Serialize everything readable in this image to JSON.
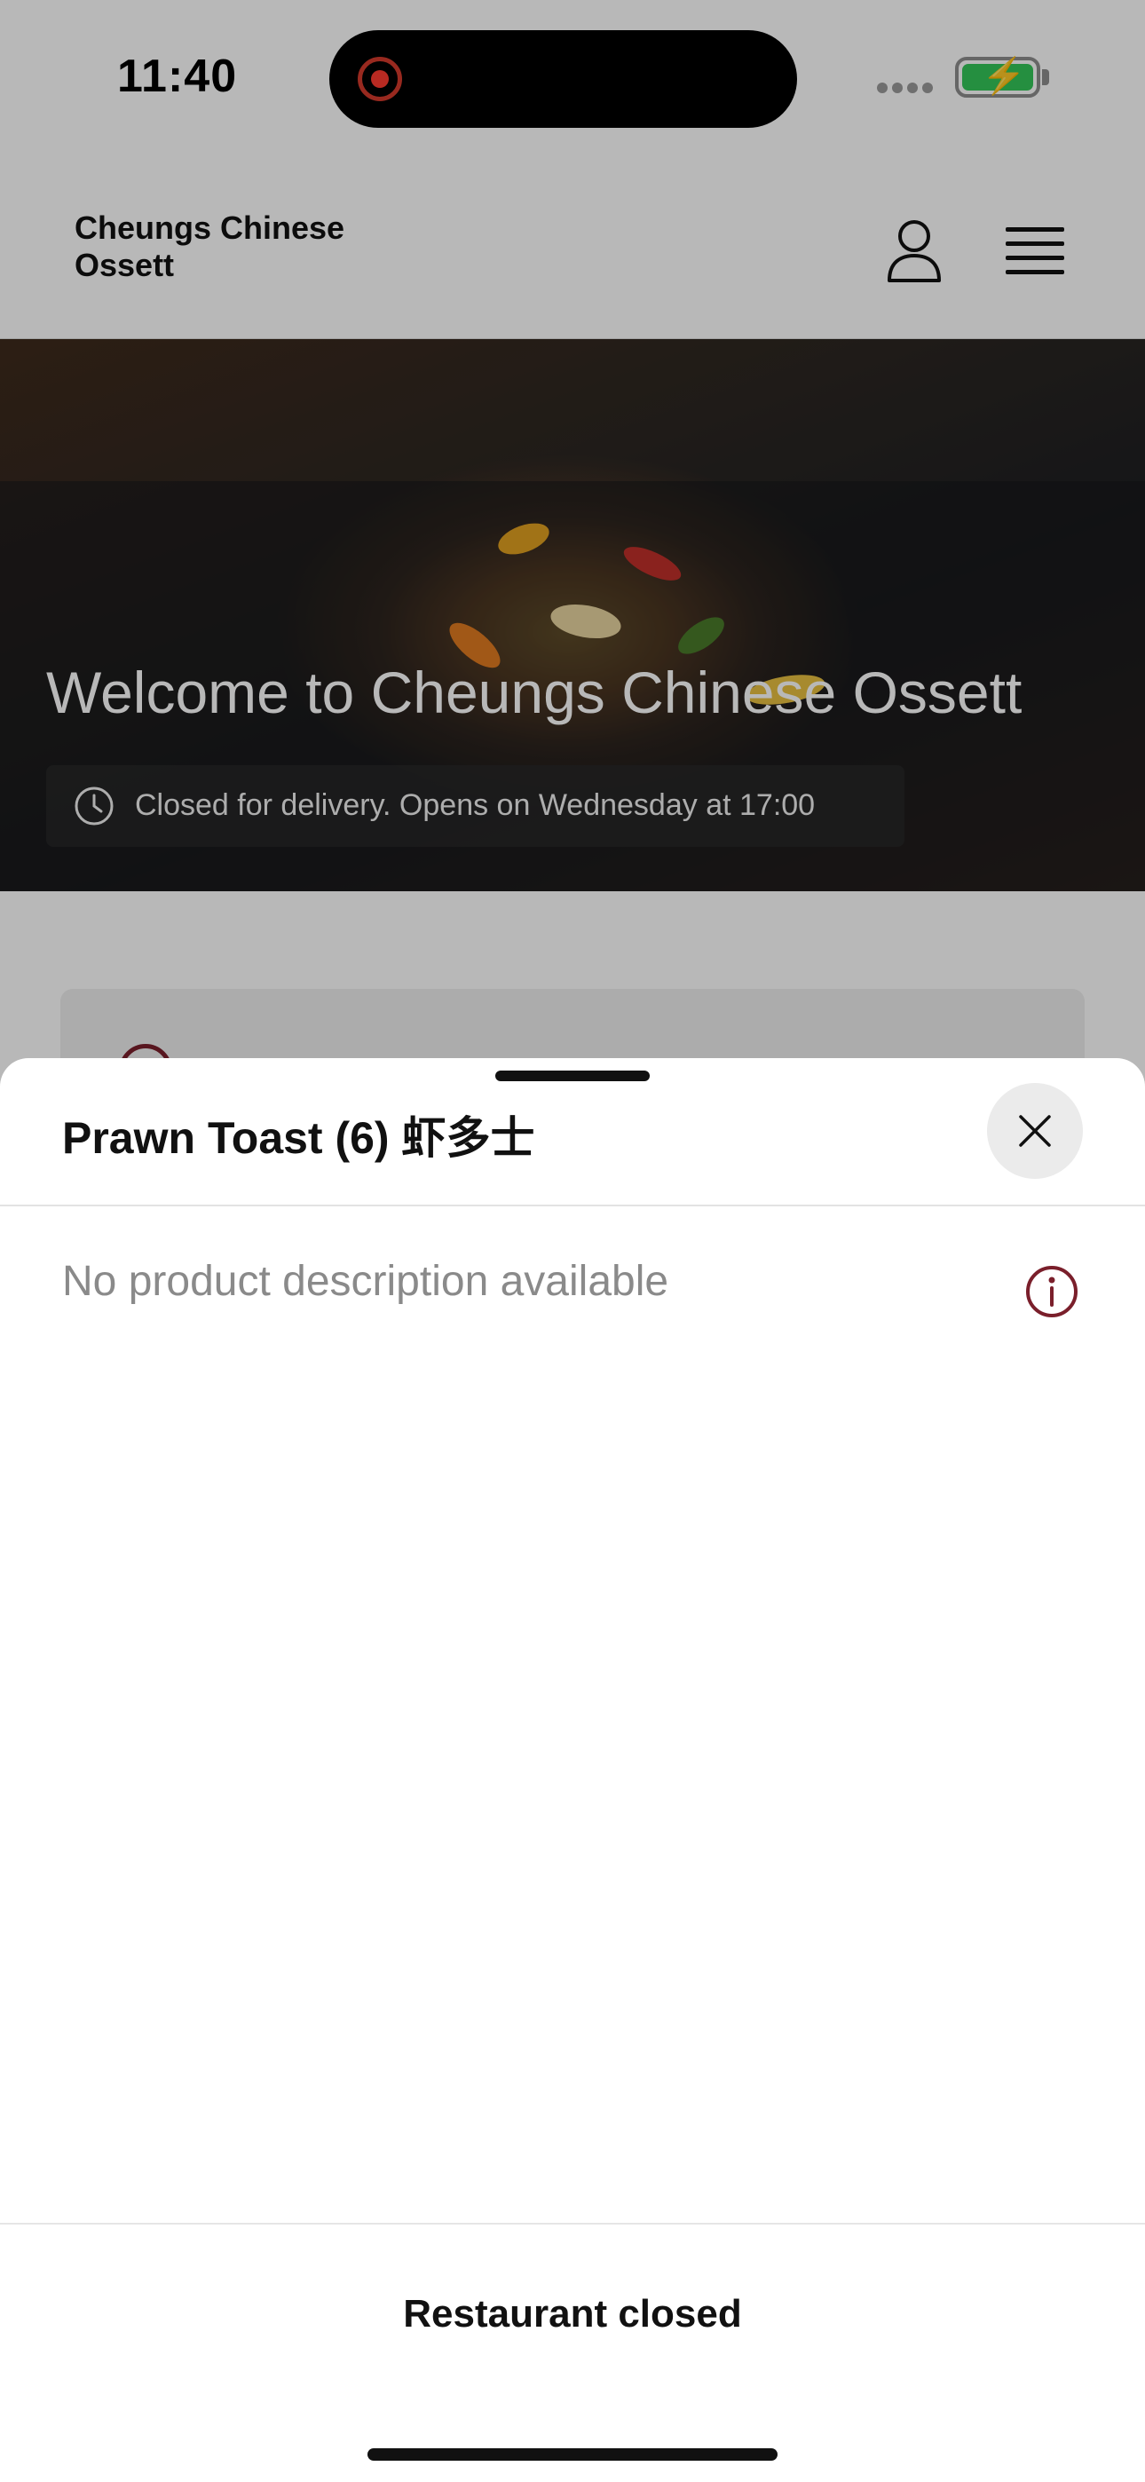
{
  "status_bar": {
    "time": "11:40"
  },
  "header": {
    "restaurant_name": "Cheungs Chinese Ossett",
    "account_icon": "user-icon",
    "menu_icon": "hamburger-menu-icon"
  },
  "hero": {
    "title": "Welcome to Cheungs Chinese Ossett",
    "status": "Closed for delivery. Opens on Wednesday at 17:00",
    "status_icon": "clock-icon"
  },
  "sheet": {
    "title": "Prawn Toast (6) 虾多士",
    "close_icon": "close-icon",
    "description": "No product description available",
    "info_icon": "info-icon",
    "footer_label": "Restaurant closed"
  },
  "colors": {
    "accent": "#7a1f2b",
    "battery": "#34c759",
    "recording": "#ff3b30"
  }
}
